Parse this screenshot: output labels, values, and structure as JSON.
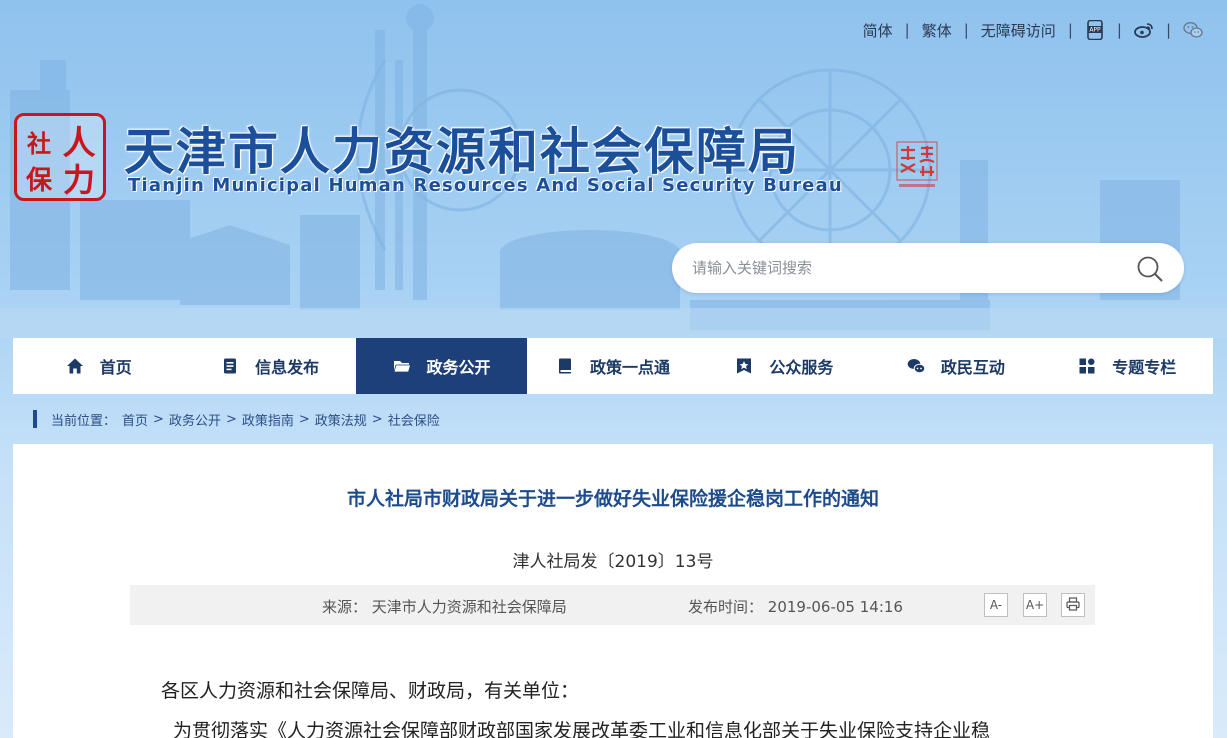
{
  "top_links": {
    "simplified": "简体",
    "traditional": "繁体",
    "accessibility": "无障碍访问"
  },
  "header": {
    "title_cn": "天津市人力资源和社会保障局",
    "title_en": "Tianjin Municipal Human Resources And Social Security Bureau",
    "logo_chars": [
      "人",
      "社",
      "力",
      "保"
    ]
  },
  "search": {
    "placeholder": "请输入关键词搜索"
  },
  "nav": {
    "items": [
      {
        "label": "首页",
        "icon": "home-icon"
      },
      {
        "label": "信息发布",
        "icon": "document-icon"
      },
      {
        "label": "政务公开",
        "icon": "folder-icon",
        "active": true
      },
      {
        "label": "政策一点通",
        "icon": "book-icon"
      },
      {
        "label": "公众服务",
        "icon": "star-badge-icon"
      },
      {
        "label": "政民互动",
        "icon": "chat-icon"
      },
      {
        "label": "专题专栏",
        "icon": "grid-icon"
      }
    ]
  },
  "breadcrumb": {
    "prefix": "当前位置：",
    "items": [
      "首页",
      "政务公开",
      "政策指南",
      "政策法规",
      "社会保险"
    ]
  },
  "article": {
    "title": "市人社局市财政局关于进一步做好失业保险援企稳岗工作的通知",
    "doc_number": "津人社局发〔2019〕13号",
    "source_label": "来源：",
    "source_value": "天津市人力资源和社会保障局",
    "time_label": "发布时间：",
    "time_value": "2019-06-05 14:16",
    "font_decrease": "A-",
    "font_increase": "A+",
    "para1": "各区人力资源和社会保障局、财政局，有关单位：",
    "para2": "为贯彻落实《人力资源社会保障部财政部国家发展改革委工业和信息化部关于失业保险支持企业稳"
  },
  "colors": {
    "brand_blue": "#1b4f99",
    "nav_active": "#1d3f7a",
    "seal_red": "#c8161d"
  }
}
